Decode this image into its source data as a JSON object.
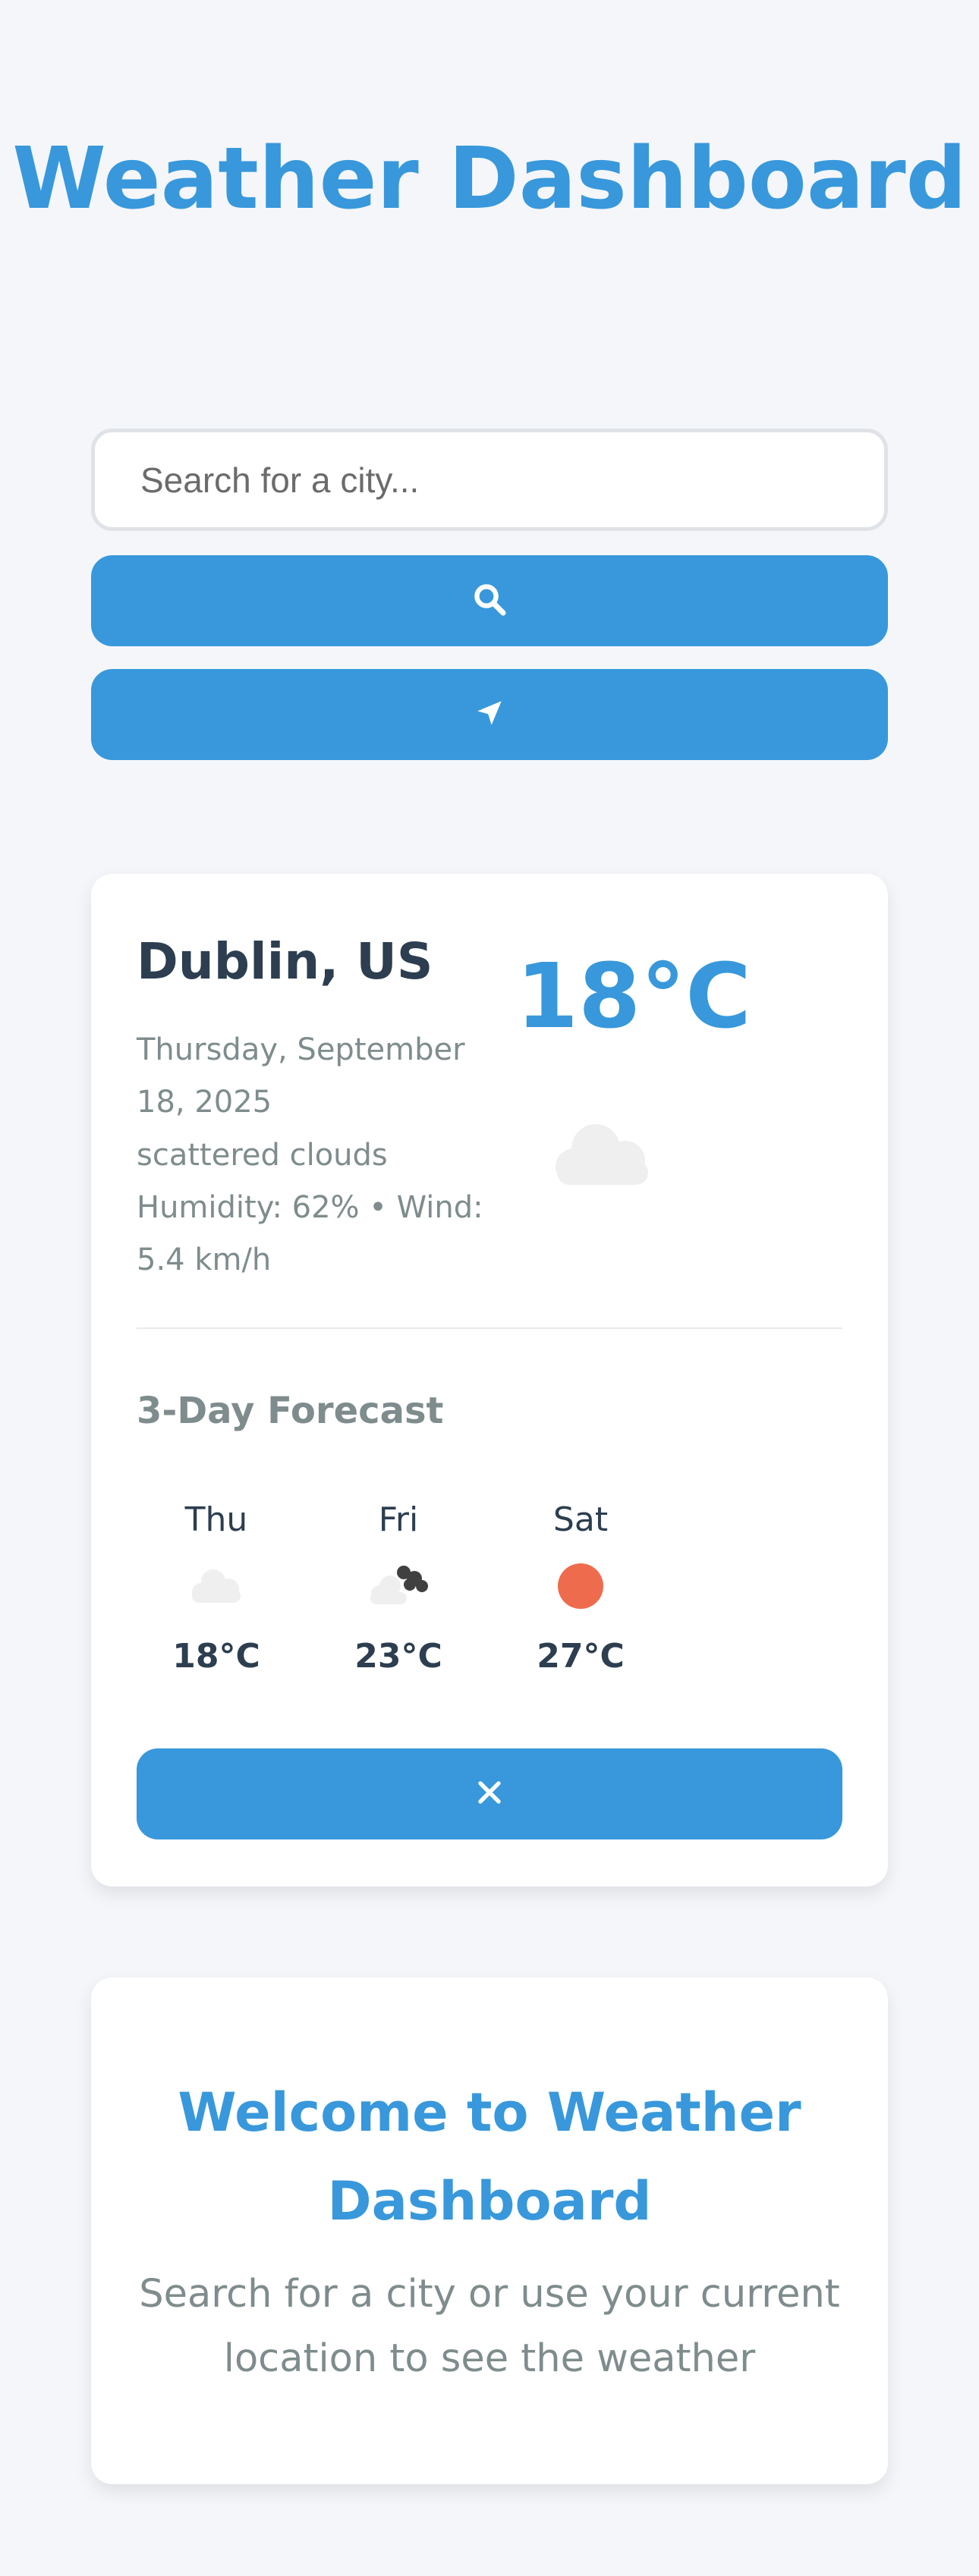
{
  "header": {
    "title": "Weather Dashboard"
  },
  "search": {
    "placeholder": "Search for a city...",
    "value": ""
  },
  "current": {
    "city": "Dublin, US",
    "date": "Thursday, September 18, 2025",
    "description": "scattered clouds",
    "details": "Humidity: 62% • Wind: 5.4 km/h",
    "temperature": "18°C",
    "icon": "cloud-icon"
  },
  "forecast": {
    "title": "3-Day Forecast",
    "days": [
      {
        "day": "Thu",
        "temp": "18°C",
        "icon": "cloud-icon"
      },
      {
        "day": "Fri",
        "temp": "23°C",
        "icon": "broken-clouds-icon"
      },
      {
        "day": "Sat",
        "temp": "27°C",
        "icon": "sun-icon"
      }
    ]
  },
  "welcome": {
    "title": "Welcome to Weather Dashboard",
    "subtitle": "Search for a city or use your current location to see the weather"
  },
  "colors": {
    "accent": "#3898db",
    "background": "#f4f6fa",
    "text_dark": "#2c3e50",
    "text_muted": "#7f8c8d",
    "sun": "#ee6c4d"
  }
}
